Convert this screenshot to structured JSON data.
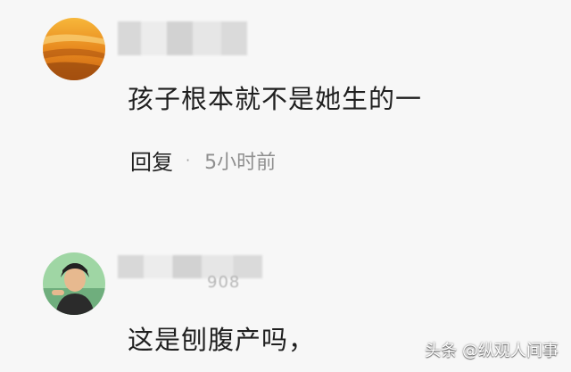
{
  "comments": [
    {
      "avatar_icon": "sunset-avatar-icon",
      "username_tail": "",
      "text": "孩子根本就不是她生的一",
      "reply_label": "回复",
      "separator": "·",
      "time": "5小时前"
    },
    {
      "avatar_icon": "person-avatar-icon",
      "username_tail": "908",
      "text": "这是刨腹产吗，"
    }
  ],
  "watermark": "头条 @纵观人间事",
  "colors": {
    "background": "#f7f7f7",
    "text": "#1f1f1f",
    "muted": "#8f8f8f"
  }
}
